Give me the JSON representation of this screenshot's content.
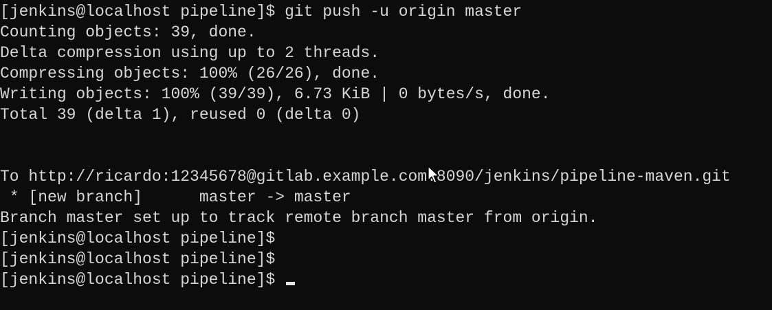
{
  "terminal": {
    "lines": [
      "[jenkins@localhost pipeline]$ git push -u origin master",
      "Counting objects: 39, done.",
      "Delta compression using up to 2 threads.",
      "Compressing objects: 100% (26/26), done.",
      "Writing objects: 100% (39/39), 6.73 KiB | 0 bytes/s, done.",
      "Total 39 (delta 1), reused 0 (delta 0)",
      "",
      "",
      "To http://ricardo:12345678@gitlab.example.com:8090/jenkins/pipeline-maven.git",
      " * [new branch]      master -> master",
      "Branch master set up to track remote branch master from origin.",
      "[jenkins@localhost pipeline]$",
      "[jenkins@localhost pipeline]$",
      "[jenkins@localhost pipeline]$ "
    ],
    "colors": {
      "background": "#0c0c0c",
      "text": "#d6d6d6",
      "cursor": "#e6e6e6"
    }
  }
}
